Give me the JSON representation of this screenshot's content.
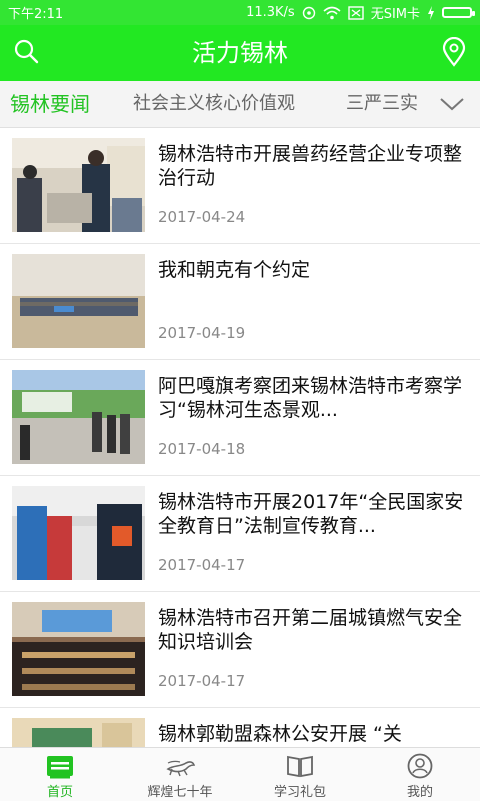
{
  "status_bar": {
    "time": "下午2:11",
    "speed": "11.3K/s",
    "sim": "无SIM卡"
  },
  "app_bar": {
    "title": "活力锡林",
    "left_icon": "search-icon",
    "right_icon": "location-pin-icon"
  },
  "tabs": [
    {
      "label": "锡林要闻",
      "active": true
    },
    {
      "label": "社会主义核心价值观",
      "active": false
    },
    {
      "label": "三严三实",
      "active": false
    }
  ],
  "news": [
    {
      "title": "锡林浩特市开展兽药经营企业专项整治行动",
      "date": "2017-04-24"
    },
    {
      "title": "我和朝克有个约定",
      "date": "2017-04-19"
    },
    {
      "title": "阿巴嘎旗考察团来锡林浩特市考察学习“锡林河生态景观...",
      "date": "2017-04-18"
    },
    {
      "title": "锡林浩特市开展2017年“全民国家安全教育日”法制宣传教育...",
      "date": "2017-04-17"
    },
    {
      "title": "锡林浩特市召开第二届城镇燃气安全知识培训会",
      "date": "2017-04-17"
    },
    {
      "title": "锡林郭勒盟森林公安开展 “关",
      "date": ""
    }
  ],
  "bottom_nav": [
    {
      "label": "首页",
      "icon": "home-icon",
      "active": true
    },
    {
      "label": "辉煌七十年",
      "icon": "horse-icon",
      "active": false
    },
    {
      "label": "学习礼包",
      "icon": "book-icon",
      "active": false
    },
    {
      "label": "我的",
      "icon": "profile-icon",
      "active": false
    }
  ],
  "colors": {
    "brand_green": "#22e822",
    "active_tab": "#22c322"
  }
}
